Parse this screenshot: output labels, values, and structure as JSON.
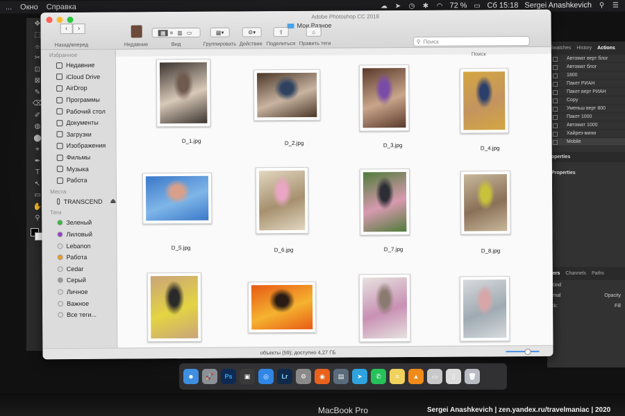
{
  "menubar": {
    "left_items": [
      "...",
      "Окно",
      "Справка"
    ],
    "battery": "72 %",
    "clock": "Сб 15:18",
    "user": "Sergei Anashkevich"
  },
  "photoshop": {
    "app_title": "Adobe Photoshop CC 2018",
    "right_tabs": [
      "Swatches",
      "History",
      "Actions"
    ],
    "actions": [
      "Автомат верт блог",
      "Автомат блог",
      "1800",
      "Пакет РИАН",
      "Пакет верт РИАН",
      "Copy",
      "Уменьш верт 800",
      "Пакет 1000",
      "Автомат 1000",
      "Хайрез-мини",
      "Mobile"
    ],
    "properties_tab": "operties",
    "properties_label": "Properties",
    "layers_tabs": [
      "yers",
      "Channels",
      "Paths"
    ],
    "layer_kind": "Kind",
    "layer_mode": "rmal",
    "layer_opacity": "Opacity",
    "layer_fill": "Fill",
    "layer_lock": "ck:"
  },
  "finder": {
    "title": "Мои Разное",
    "nav_label": "Назад/вперед",
    "toolbar": {
      "recent": "Недавние",
      "view": "Вид",
      "group": "Группировать",
      "action": "Действие",
      "share": "Поделиться",
      "tags": "Править теги",
      "search_placeholder": "Поиск",
      "search_label": "Поиск"
    },
    "sidebar": {
      "favorites_head": "Избранное",
      "favorites": [
        "Недавние",
        "iCloud Drive",
        "AirDrop",
        "Программы",
        "Рабочий стол",
        "Документы",
        "Загрузки",
        "Изображения",
        "Фильмы",
        "Музыка",
        "Работа"
      ],
      "places_head": "Места",
      "places": [
        "TRANSCEND"
      ],
      "tags_head": "Теги",
      "tags": [
        {
          "label": "Зеленый",
          "color": "#2fbf3a"
        },
        {
          "label": "Лиловый",
          "color": "#9a3fd1"
        },
        {
          "label": "Lebanon",
          "color": "#d8d8d8"
        },
        {
          "label": "Работа",
          "color": "#f29c1c"
        },
        {
          "label": "Cedar",
          "color": "#d8d8d8"
        },
        {
          "label": "Серый",
          "color": "#9a9a9a"
        },
        {
          "label": "Личное",
          "color": "#d8d8d8"
        },
        {
          "label": "Важное",
          "color": "#d8d8d8"
        },
        {
          "label": "Все теги...",
          "color": "#d8d8d8"
        }
      ]
    },
    "files": [
      {
        "name": "D_1.jpg",
        "palette": [
          "#3b3430",
          "#d8c9b8",
          "#6e5a4e"
        ]
      },
      {
        "name": "D_2.jpg",
        "palette": [
          "#4a3728",
          "#c8b4a0",
          "#2e4260"
        ]
      },
      {
        "name": "D_3.jpg",
        "palette": [
          "#5a3a2c",
          "#c9a58a",
          "#7a4ba8"
        ]
      },
      {
        "name": "D_4.jpg",
        "palette": [
          "#d4a642",
          "#c3945f",
          "#2b3f6b"
        ]
      },
      {
        "name": "D_5.jpg",
        "palette": [
          "#3a78c8",
          "#7fb6e8",
          "#d8a08a"
        ]
      },
      {
        "name": "D_6.jpg",
        "palette": [
          "#e2d7c0",
          "#a6906e",
          "#e9a5c3"
        ]
      },
      {
        "name": "D_7.jpg",
        "palette": [
          "#4f7b3a",
          "#d89ab0",
          "#2d2d35"
        ]
      },
      {
        "name": "D_8.jpg",
        "palette": [
          "#c8b89a",
          "#8a7058",
          "#c7c23a"
        ]
      },
      {
        "name": "",
        "palette": [
          "#c9a47a",
          "#e4d442",
          "#2a2a2a"
        ]
      },
      {
        "name": "",
        "palette": [
          "#e85a14",
          "#f5b330",
          "#2a1c14"
        ]
      },
      {
        "name": "",
        "palette": [
          "#e6e3df",
          "#c990b4",
          "#8a7a70"
        ]
      },
      {
        "name": "",
        "palette": [
          "#d7dadc",
          "#9eaab2",
          "#d9a6a8"
        ]
      }
    ],
    "status": "объекты (59); доступно 4,27 ГБ"
  },
  "dock": {
    "apps": [
      "finder-icon",
      "launchpad-icon",
      "photoshop-icon",
      "photo-icon",
      "safari-icon",
      "lightroom-icon",
      "settings-icon",
      "firefox-icon",
      "screenshot-icon",
      "telegram-icon",
      "whatsapp-icon",
      "notes-icon",
      "vlc-icon",
      "scanner-icon",
      "preview-icon",
      "trash-icon"
    ],
    "labels": {
      "photoshop": "Ps",
      "lightroom": "Lr"
    }
  },
  "bezel": {
    "brand": "MacBook Pro",
    "credit": "Sergei Anashkevich | zen.yandex.ru/travelmaniac | 2020"
  }
}
